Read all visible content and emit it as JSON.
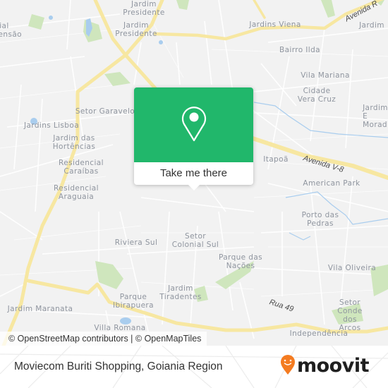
{
  "map": {
    "place_labels": [
      {
        "id": "jardim-presidente-1",
        "text": "Jardim\nPresidente"
      },
      {
        "id": "jardim-presidente-2",
        "text": "Jardim\nPresidente"
      },
      {
        "id": "residencial-extensao",
        "text": "cial\ntensão"
      },
      {
        "id": "jardins-viena",
        "text": "Jardins Viena"
      },
      {
        "id": "bairro-ilda",
        "text": "Bairro Ilda"
      },
      {
        "id": "vila-mariana",
        "text": "Vila Mariana"
      },
      {
        "id": "cidade-vera-cruz",
        "text": "Cidade\nVera Cruz"
      },
      {
        "id": "jardim-morada",
        "text": "Jardim E\nMorad"
      },
      {
        "id": "jardim-top-right",
        "text": "Jardim"
      },
      {
        "id": "setor-garavelo",
        "text": "Setor Garavelo"
      },
      {
        "id": "jardins-lisboa",
        "text": "Jardins Lisboa"
      },
      {
        "id": "jardim-das-hortencias",
        "text": "Jardim das\nHortências"
      },
      {
        "id": "residencial-caraibas",
        "text": "Residencial\nCaraíbas"
      },
      {
        "id": "residencial-araguaia",
        "text": "Residencial\nAraguaia"
      },
      {
        "id": "itapoa",
        "text": "Itapoã"
      },
      {
        "id": "american-park",
        "text": "American Park"
      },
      {
        "id": "porto-das-pedras",
        "text": "Porto das\nPedras"
      },
      {
        "id": "riviera-sul",
        "text": "Riviera Sul"
      },
      {
        "id": "setor-colonial-sul",
        "text": "Setor\nColonial Sul"
      },
      {
        "id": "parque-das-nacoes",
        "text": "Parque das\nNações"
      },
      {
        "id": "vila-oliveira",
        "text": "Vila Oliveira"
      },
      {
        "id": "jardim-tiradentes",
        "text": "Jardim\nTiradentes"
      },
      {
        "id": "parque-ibirapuera",
        "text": "Parque\nIbirapuera"
      },
      {
        "id": "setor-conde-dos-arcos",
        "text": "Setor Conde\ndos Arcos"
      },
      {
        "id": "jardim-maranata",
        "text": "Jardim Maranata"
      },
      {
        "id": "villa-romana",
        "text": "Villa Romana"
      },
      {
        "id": "independencia",
        "text": "Independência"
      }
    ],
    "road_labels": [
      {
        "id": "avenida-v8",
        "text": "Avenida V-8"
      },
      {
        "id": "rua-49",
        "text": "Rua 49"
      },
      {
        "id": "avenida-top",
        "text": "Avenida R"
      }
    ],
    "colors": {
      "background": "#f2f2f2",
      "major_road": "#f7e7a1",
      "minor_road": "#ffffff",
      "park": "#cfe6bd",
      "water": "#a9cdee"
    }
  },
  "popup": {
    "icon": "map-pin-icon",
    "action_label": "Take me there",
    "accent_color": "#21b76b"
  },
  "attribution": {
    "text": "© OpenStreetMap contributors | © OpenMapTiles"
  },
  "footer": {
    "title": "Moviecom Buriti Shopping, Goiania Region",
    "logo_text": "moovit",
    "logo_icon": "moovit-smiley-pin-icon",
    "logo_color": "#f47b20"
  }
}
